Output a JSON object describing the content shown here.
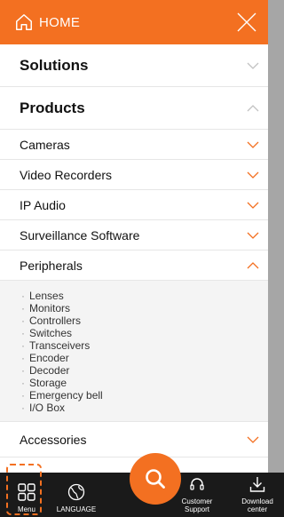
{
  "header": {
    "home_label": "HOME"
  },
  "menu": {
    "solutions": "Solutions",
    "products": "Products",
    "cameras": "Cameras",
    "video_recorders": "Video Recorders",
    "ip_audio": "IP Audio",
    "surveillance_software": "Surveillance Software",
    "peripherals": "Peripherals",
    "accessories": "Accessories"
  },
  "peripherals_items": {
    "0": "Lenses",
    "1": "Monitors",
    "2": "Controllers",
    "3": "Switches",
    "4": "Transceivers",
    "5": "Encoder",
    "6": "Decoder",
    "7": "Storage",
    "8": "Emergency bell",
    "9": "I/O Box"
  },
  "bullet_char": "·",
  "bottom_bar": {
    "menu": "Menu",
    "language": "LANGUAGE",
    "customer_support": "Customer Support",
    "download_center": "Download center"
  },
  "colors": {
    "accent": "#f37021",
    "bottom_bar": "#1a1a1a",
    "sublist_bg": "#f4f4f4"
  },
  "icons": {
    "header": [
      "home-icon",
      "close-icon"
    ],
    "bottom": [
      "grid-icon",
      "globe-icon",
      "search-icon",
      "headset-icon",
      "download-icon"
    ]
  }
}
